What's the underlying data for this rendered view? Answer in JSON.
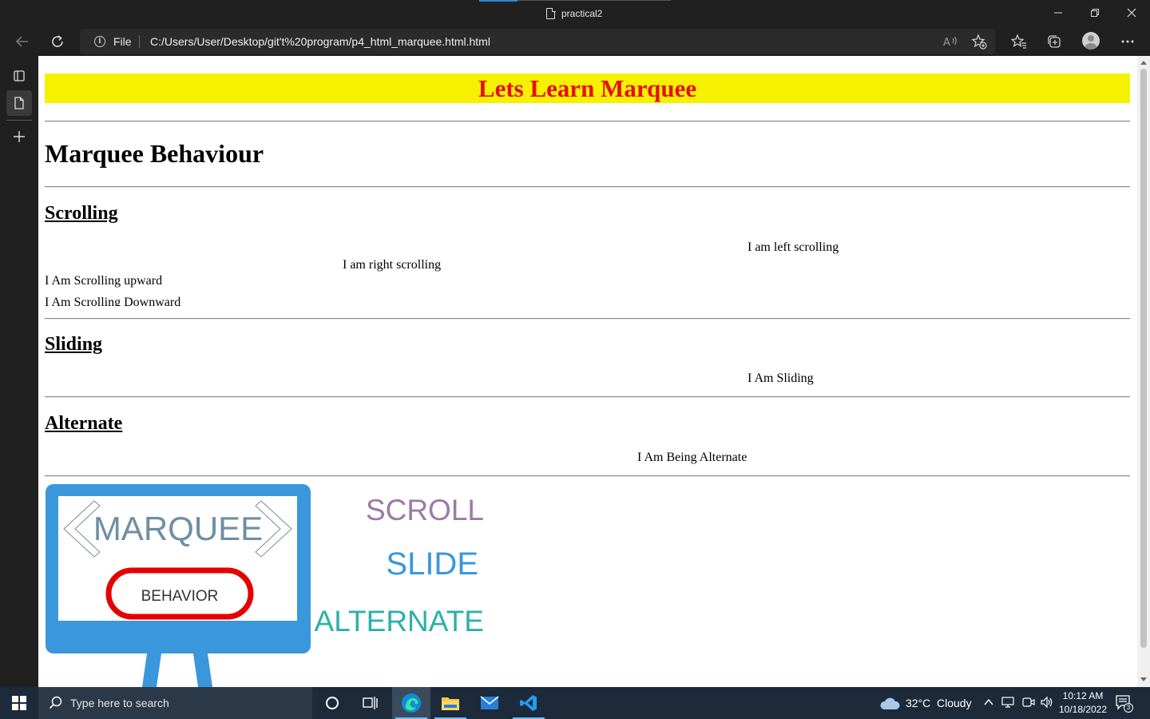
{
  "browser": {
    "tab_title": "practical2",
    "address": {
      "scheme_label": "File",
      "url": "C:/Users/User/Desktop/git't%20program/p4_html_marquee.html.html"
    }
  },
  "page": {
    "banner": "Lets Learn Marquee",
    "heading": "Marquee Behaviour",
    "sections": {
      "scrolling": {
        "title": "Scrolling",
        "left": "I am left scrolling",
        "right": "I am right scrolling",
        "up": "I Am Scrolling upward",
        "down": "I Am Scrolling Downward"
      },
      "sliding": {
        "title": "Sliding",
        "text": "I Am Sliding"
      },
      "alternate": {
        "title": "Alternate",
        "text": "I Am Being Alternate"
      }
    },
    "logo": {
      "title": "MARQUEE",
      "badge": "BEHAVIOR",
      "words": [
        "SCROLL",
        "SLIDE",
        "ALTERNATE"
      ],
      "colors": {
        "monitor": "#3a97db",
        "marquee_text": "#6e8ea3",
        "badge_ring": "#e60000",
        "scroll": "#9c7aa6",
        "slide": "#3a97db",
        "alternate": "#2bb1a9"
      }
    },
    "colors": {
      "banner_bg": "#f5f100",
      "banner_text": "#e71010"
    }
  },
  "taskbar": {
    "search_placeholder": "Type here to search",
    "weather": {
      "temp": "32°C",
      "condition": "Cloudy"
    },
    "clock": {
      "time": "10:12 AM",
      "date": "10/18/2022"
    },
    "notification_count": "3"
  }
}
